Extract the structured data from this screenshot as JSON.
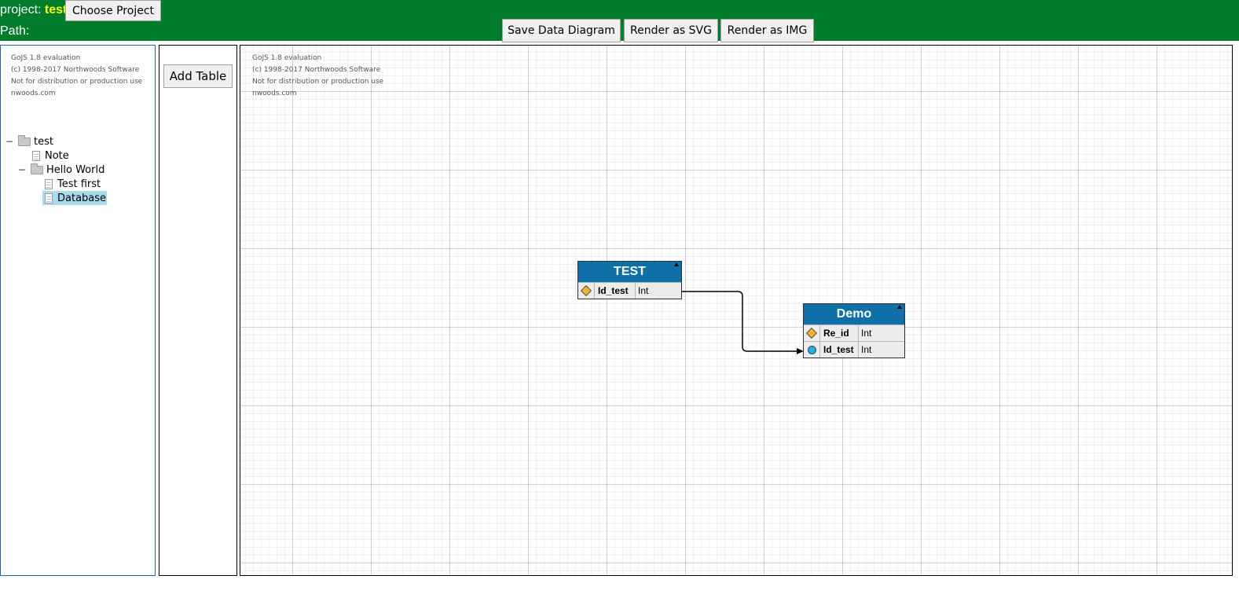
{
  "header": {
    "project_label": "project:",
    "project_name": "test",
    "choose_project": "Choose Project",
    "path_label": "Path:",
    "save_diagram": "Save Data Diagram",
    "render_svg": "Render as SVG",
    "render_img": "Render as IMG"
  },
  "colors": {
    "topbar": "#007c2a",
    "project_name": "#ffff00",
    "entity_header": "#0f70a8",
    "selected": "#a9dbef"
  },
  "watermark": [
    "GoJS 1.8 evaluation",
    "(c) 1998-2017 Northwoods Software",
    "Not for distribution or production use",
    "nwoods.com"
  ],
  "tree": {
    "items": [
      {
        "label": "test",
        "type": "folder",
        "expanded": true,
        "toggle": "−"
      },
      {
        "label": "Note",
        "type": "document"
      },
      {
        "label": "Hello World",
        "type": "folder",
        "expanded": true,
        "toggle": "−"
      },
      {
        "label": "Test first",
        "type": "document"
      },
      {
        "label": "Database",
        "type": "document",
        "selected": true
      }
    ]
  },
  "tools": {
    "add_table": "Add Table"
  },
  "diagram": {
    "entities": [
      {
        "name": "TEST",
        "attributes": [
          {
            "name": "Id_test",
            "type": "Int",
            "key": "primary"
          }
        ]
      },
      {
        "name": "Demo",
        "attributes": [
          {
            "name": "Re_id",
            "type": "Int",
            "key": "primary"
          },
          {
            "name": "Id_test",
            "type": "Int",
            "key": "foreign"
          }
        ]
      }
    ],
    "links": [
      {
        "from": "TEST.Id_test",
        "to": "Demo.Id_test"
      }
    ]
  }
}
